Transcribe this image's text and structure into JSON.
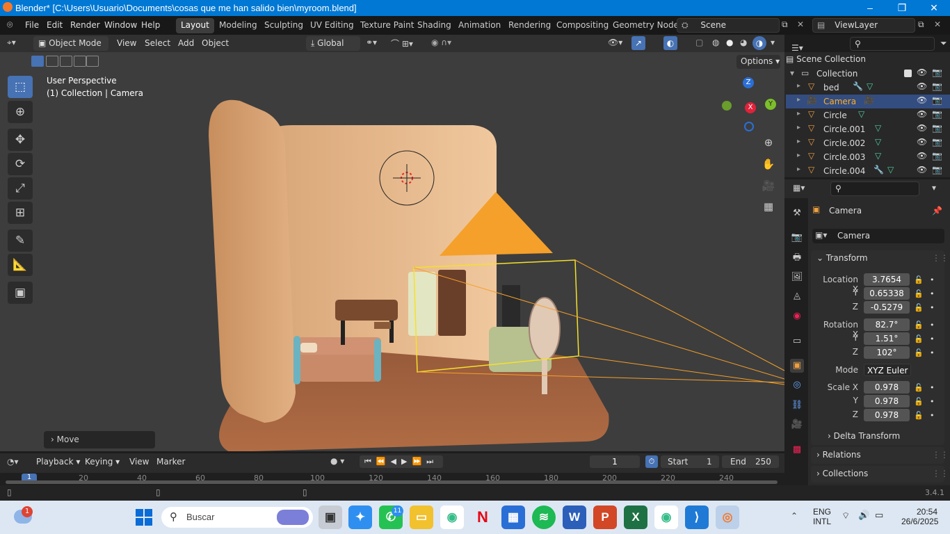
{
  "window": {
    "title": "Blender* [C:\\Users\\Usuario\\Documents\\cosas que me han salido bien\\myroom.blend]"
  },
  "menu": {
    "file": "File",
    "edit": "Edit",
    "render": "Render",
    "window": "Window",
    "help": "Help"
  },
  "workspaces": [
    "Layout",
    "Modeling",
    "Sculpting",
    "UV Editing",
    "Texture Paint",
    "Shading",
    "Animation",
    "Rendering",
    "Compositing",
    "Geometry Node"
  ],
  "scene": {
    "name": "Scene",
    "view_layer": "ViewLayer"
  },
  "viewport_header": {
    "mode": "Object Mode",
    "view": "View",
    "select": "Select",
    "add": "Add",
    "object": "Object",
    "orientation": "Global",
    "options": "Options"
  },
  "viewport": {
    "perspective": "User Perspective",
    "context": "(1) Collection | Camera",
    "last_op": "Move"
  },
  "gizmo": {
    "z": "Z",
    "y": "Y",
    "x": "X"
  },
  "outliner": {
    "title": "Scene Collection",
    "collection": "Collection",
    "items": [
      {
        "name": "bed"
      },
      {
        "name": "Camera"
      },
      {
        "name": "Circle"
      },
      {
        "name": "Circle.001"
      },
      {
        "name": "Circle.002"
      },
      {
        "name": "Circle.003"
      },
      {
        "name": "Circle.004"
      }
    ]
  },
  "properties": {
    "object_name": "Camera",
    "data_name": "Camera",
    "transform_title": "Transform",
    "location": {
      "label": "Location X",
      "x": "3.7654",
      "y": "0.65338",
      "z": "-0.5279"
    },
    "rotation": {
      "label": "Rotation X",
      "x": "82.7°",
      "y": "1.51°",
      "z": "102°"
    },
    "mode_label": "Mode",
    "mode_value": "XYZ Euler",
    "scale": {
      "label": "Scale X",
      "x": "0.978",
      "y": "0.978",
      "z": "0.978"
    },
    "y": "Y",
    "z": "Z",
    "delta": "Delta Transform",
    "relations": "Relations",
    "collections": "Collections"
  },
  "timeline": {
    "playback": "Playback",
    "keying": "Keying",
    "view": "View",
    "marker": "Marker",
    "current_frame": "1",
    "start_label": "Start",
    "start": "1",
    "end_label": "End",
    "end": "250",
    "ticks": [
      "1",
      "20",
      "40",
      "60",
      "80",
      "100",
      "120",
      "140",
      "160",
      "180",
      "200",
      "220",
      "240"
    ]
  },
  "status": {
    "version": "3.4.1"
  },
  "taskbar": {
    "search": "Buscar",
    "lang1": "ENG",
    "lang2": "INTL",
    "time": "20:54",
    "date": "26/6/2025",
    "notif": "1",
    "whatsapp_badge": "11"
  }
}
